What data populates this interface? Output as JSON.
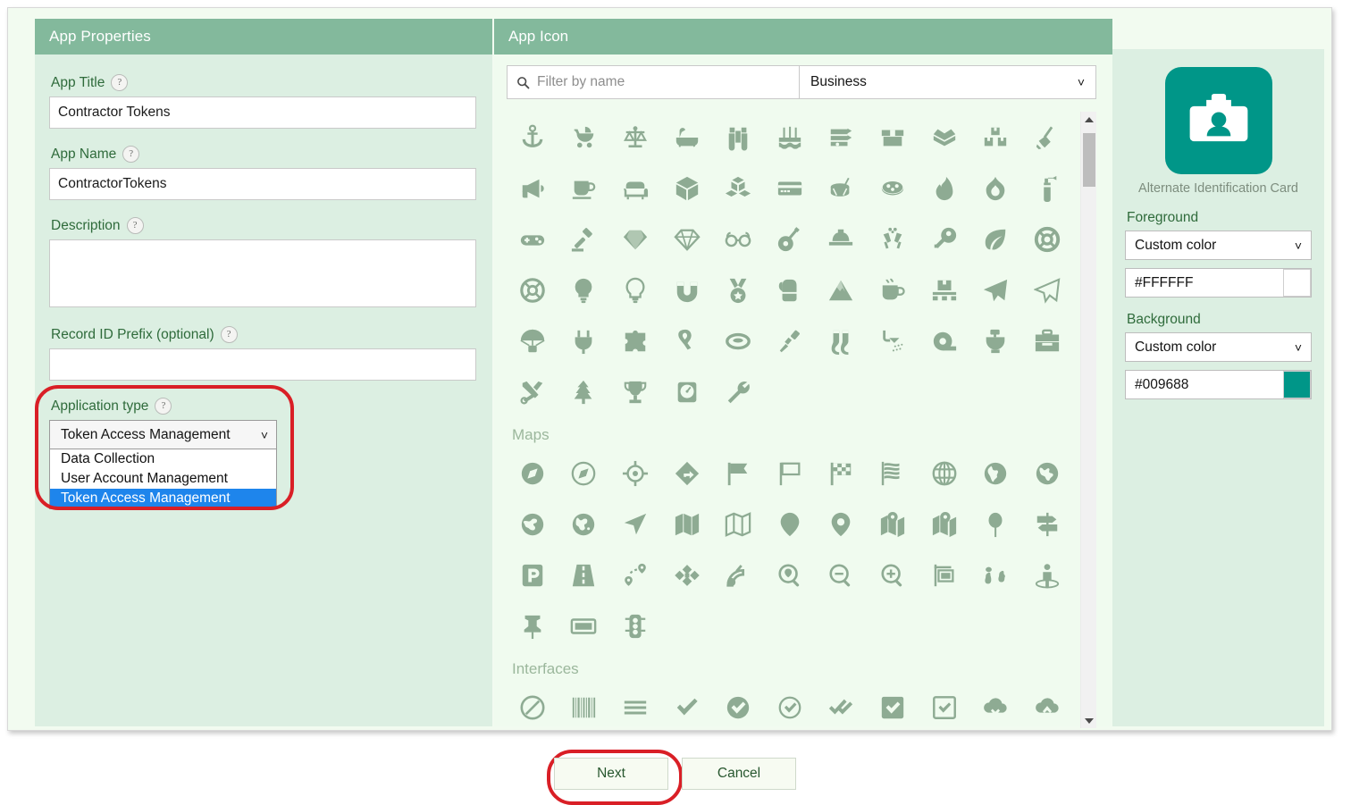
{
  "panels": {
    "left_title": "App Properties",
    "middle_title": "App Icon"
  },
  "form": {
    "app_title": {
      "label": "App Title",
      "value": "Contractor Tokens",
      "help": "?"
    },
    "app_name": {
      "label": "App Name",
      "value": "ContractorTokens",
      "help": "?"
    },
    "description": {
      "label": "Description",
      "value": "",
      "placeholder": "",
      "help": "?"
    },
    "record_id_prefix": {
      "label": "Record ID Prefix (optional)",
      "value": "",
      "placeholder": "",
      "help": "?"
    },
    "application_type": {
      "label": "Application type",
      "help": "?",
      "selected": "Token Access Management",
      "expanded": true,
      "options": [
        "Data Collection",
        "User Account Management",
        "Token Access Management"
      ],
      "highlight_color": "#d91f26",
      "option_selected_bg": "#1e85ec"
    }
  },
  "icon_picker": {
    "search_placeholder": "Filter by name",
    "search_value": "",
    "category_selected": "Business",
    "sections": [
      {
        "title": "",
        "icons": [
          "anchor-icon",
          "baby-carriage-icon",
          "balance-scale-icon",
          "bathtub-icon",
          "binoculars-icon",
          "bridge-icon",
          "bill-spike-icon",
          "box-icon",
          "open-box-icon",
          "boxes-stacked-icon",
          "broom-icon",
          "bullhorn-icon",
          "coffee-cup-icon",
          "couch-icon",
          "cube-icon",
          "cubes-icon",
          "credit-card-icon",
          "drum-icon",
          "drum-top-icon",
          "flame-icon",
          "fire-icon",
          "fire-extinguisher-icon",
          "gamepad-icon",
          "gavel-icon",
          "gem-icon",
          "diamond-icon",
          "glasses-icon",
          "guitar-icon",
          "hard-hat-icon",
          "cheers-icon",
          "key-icon",
          "leaf-icon",
          "life-ring-icon",
          "lifebuoy-icon",
          "lightbulb-icon",
          "lightbulb-outline-icon",
          "magnet-icon",
          "medal-icon",
          "mitten-icon",
          "mountain-icon",
          "mug-hot-icon",
          "pallet-icon",
          "paper-plane-icon",
          "paper-plane-outline-icon",
          "parachute-icon",
          "plug-icon",
          "puzzle-piece-icon",
          "ribbon-icon",
          "ring-icon",
          "screwdriver-icon",
          "socks-icon",
          "shower-icon",
          "tape-icon",
          "toilet-icon",
          "toolbox-icon",
          "tools-icon",
          "tree-icon",
          "trophy-icon",
          "weight-scale-icon",
          "wrench-icon"
        ]
      },
      {
        "title": "Maps",
        "icons": [
          "compass-filled-icon",
          "compass-outline-icon",
          "crosshairs-icon",
          "diamond-turn-right-icon",
          "flag-filled-icon",
          "flag-outline-icon",
          "flag-checkered-icon",
          "flag-usa-icon",
          "globe-grid-icon",
          "earth-africa-icon",
          "earth-americas-icon",
          "earth-europe-icon",
          "earth-asia-icon",
          "location-arrow-icon",
          "map-filled-icon",
          "map-outline-icon",
          "map-pin-icon",
          "location-dot-icon",
          "map-marked-icon",
          "map-location-dot-icon",
          "pin-icon",
          "signpost-icon",
          "parking-icon",
          "road-icon",
          "route-icon",
          "satellite-icon",
          "satellite-dish-icon",
          "search-location-icon",
          "magnifying-glass-minus-icon",
          "magnifying-glass-plus-icon",
          "sign-hanging-icon",
          "shoe-prints-icon",
          "street-view-icon",
          "thumbtack-icon",
          "ticket-icon",
          "traffic-light-icon"
        ]
      },
      {
        "title": "Interfaces",
        "icons": [
          "ban-icon",
          "barcode-icon",
          "bars-icon",
          "check-icon",
          "circle-check-filled-icon",
          "circle-check-outline-icon",
          "check-double-icon",
          "square-check-filled-icon",
          "square-check-outline-icon",
          "cloud-download-icon",
          "cloud-upload-icon"
        ]
      }
    ],
    "scrollbar": {
      "up": "scroll-up-arrow",
      "down": "scroll-down-arrow"
    }
  },
  "preview": {
    "icon_name": "Alternate Identification Card",
    "icon_glyph": "id-card-icon",
    "foreground": {
      "label": "Foreground",
      "mode": "Custom color",
      "hex": "#FFFFFF"
    },
    "background": {
      "label": "Background",
      "mode": "Custom color",
      "hex": "#009688"
    }
  },
  "footer": {
    "next_label": "Next",
    "cancel_label": "Cancel",
    "highlight_color": "#d91f26"
  }
}
